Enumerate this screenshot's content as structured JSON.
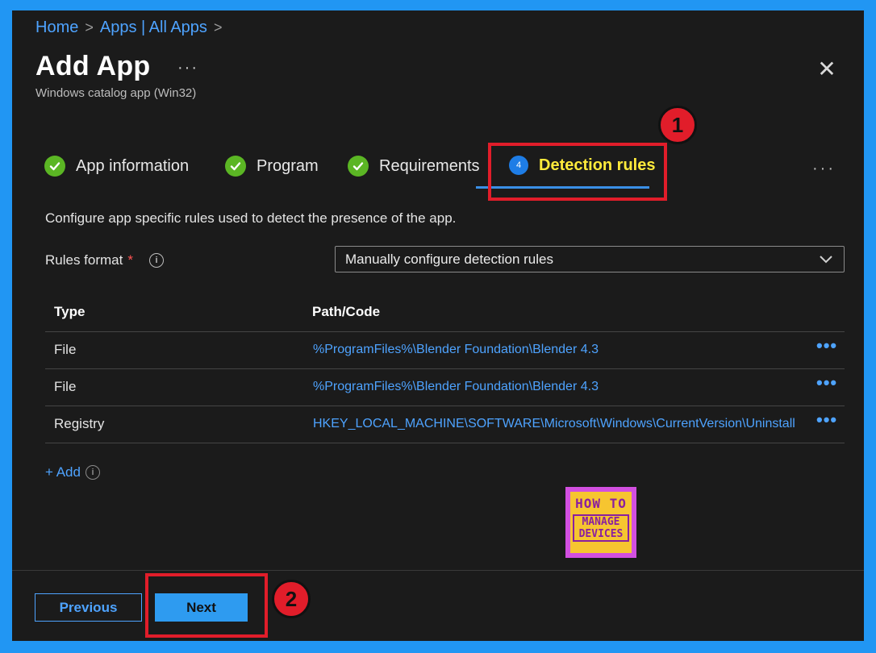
{
  "breadcrumb": {
    "home": "Home",
    "separator": ">",
    "apps": "Apps | All Apps"
  },
  "header": {
    "title": "Add App",
    "more": "···",
    "subtitle": "Windows catalog app (Win32)",
    "close": "✕"
  },
  "steps": [
    {
      "label": "App information",
      "status": "complete"
    },
    {
      "label": "Program",
      "status": "complete"
    },
    {
      "label": "Requirements",
      "status": "complete"
    },
    {
      "label": "Detection rules",
      "number": "4",
      "status": "active"
    }
  ],
  "tabs_more": "···",
  "callouts": {
    "one": "1",
    "two": "2"
  },
  "description": "Configure app specific rules used to detect the presence of the app.",
  "rules_format": {
    "label": "Rules format",
    "required": "*",
    "info": "i",
    "value": "Manually configure detection rules"
  },
  "table": {
    "headers": {
      "type": "Type",
      "path": "Path/Code"
    },
    "rows": [
      {
        "type": "File",
        "path": "%ProgramFiles%\\Blender Foundation\\Blender 4.3"
      },
      {
        "type": "File",
        "path": "%ProgramFiles%\\Blender Foundation\\Blender 4.3"
      },
      {
        "type": "Registry",
        "path": "HKEY_LOCAL_MACHINE\\SOFTWARE\\Microsoft\\Windows\\CurrentVersion\\Uninstall"
      }
    ],
    "row_more": "•••"
  },
  "add": {
    "label": "+ Add",
    "info": "i"
  },
  "logo": {
    "line1": "HOW TO",
    "line2": "MANAGE DEVICES"
  },
  "footer": {
    "previous": "Previous",
    "next": "Next"
  },
  "colors": {
    "accent": "#2e9bf0",
    "success": "#5bb624",
    "highlight": "#e11d2a",
    "active_step": "#ffeb3b"
  }
}
